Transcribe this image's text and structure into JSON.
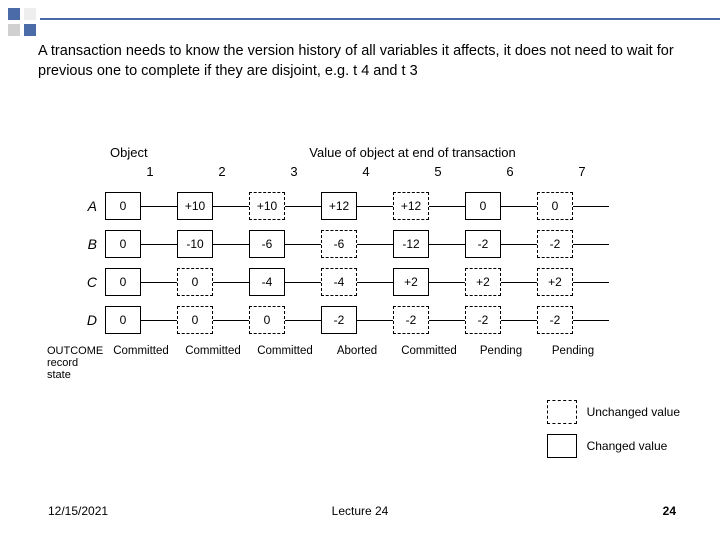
{
  "body_text": "A transaction needs to know the version history of all variables it affects, it does not need to wait for previous one to complete if they are disjoint, e.g. t 4 and t 3",
  "diagram": {
    "object_label": "Object",
    "title": "Value of object at end of transaction",
    "columns": [
      "1",
      "2",
      "3",
      "4",
      "5",
      "6",
      "7"
    ],
    "rows": [
      {
        "label": "A",
        "cells": [
          {
            "v": "0",
            "style": "solid"
          },
          {
            "v": "+10",
            "style": "solid"
          },
          {
            "v": "+10",
            "style": "dashed"
          },
          {
            "v": "+12",
            "style": "solid"
          },
          {
            "v": "+12",
            "style": "dashed"
          },
          {
            "v": "0",
            "style": "solid"
          },
          {
            "v": "0",
            "style": "dashed"
          }
        ]
      },
      {
        "label": "B",
        "cells": [
          {
            "v": "0",
            "style": "solid"
          },
          {
            "v": "-10",
            "style": "solid"
          },
          {
            "v": "-6",
            "style": "solid"
          },
          {
            "v": "-6",
            "style": "dashed"
          },
          {
            "v": "-12",
            "style": "solid"
          },
          {
            "v": "-2",
            "style": "solid"
          },
          {
            "v": "-2",
            "style": "dashed"
          }
        ]
      },
      {
        "label": "C",
        "cells": [
          {
            "v": "0",
            "style": "solid"
          },
          {
            "v": "0",
            "style": "dashed"
          },
          {
            "v": "-4",
            "style": "solid"
          },
          {
            "v": "-4",
            "style": "dashed"
          },
          {
            "v": "+2",
            "style": "solid"
          },
          {
            "v": "+2",
            "style": "dashed"
          },
          {
            "v": "+2",
            "style": "dashed"
          }
        ]
      },
      {
        "label": "D",
        "cells": [
          {
            "v": "0",
            "style": "solid"
          },
          {
            "v": "0",
            "style": "dashed"
          },
          {
            "v": "0",
            "style": "dashed"
          },
          {
            "v": "-2",
            "style": "solid"
          },
          {
            "v": "-2",
            "style": "dashed"
          },
          {
            "v": "-2",
            "style": "dashed"
          },
          {
            "v": "-2",
            "style": "dashed"
          }
        ]
      }
    ],
    "outcome_label": "OUTCOME record state",
    "outcomes": [
      "Committed",
      "Committed",
      "Committed",
      "Aborted",
      "Committed",
      "Pending",
      "Pending"
    ]
  },
  "legend": {
    "unchanged": "Unchanged value",
    "changed": "Changed value"
  },
  "footer": {
    "date": "12/15/2021",
    "lecture": "Lecture 24",
    "page": "24"
  }
}
